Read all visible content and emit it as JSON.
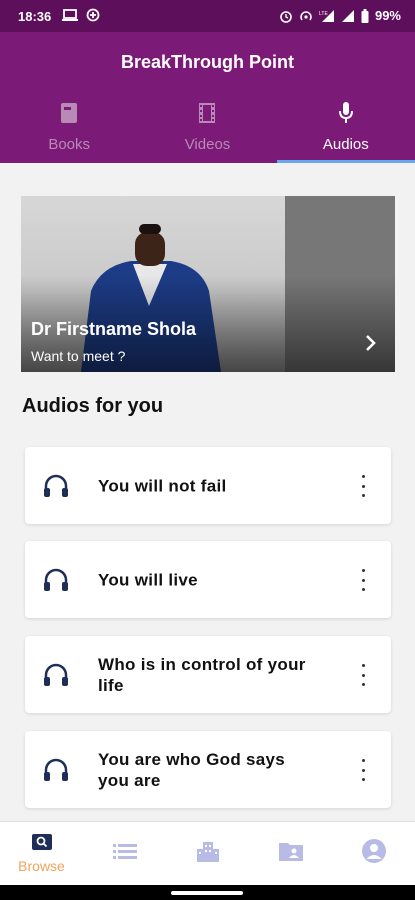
{
  "status_bar": {
    "time": "18:36",
    "battery": "99%"
  },
  "app_bar": {
    "title": "BreakThrough Point"
  },
  "tabs": [
    {
      "label": "Books",
      "icon": "book-icon",
      "active": false
    },
    {
      "label": "Videos",
      "icon": "film-icon",
      "active": false
    },
    {
      "label": "Audios",
      "icon": "microphone-icon",
      "active": true
    }
  ],
  "banner": {
    "name": "Dr Firstname Shola",
    "subtitle": "Want to meet ?"
  },
  "section": {
    "title": "Audios for you"
  },
  "audios": [
    {
      "title": "You will not fail"
    },
    {
      "title": "You will live"
    },
    {
      "title": "Who is in control of your life"
    },
    {
      "title": "You are who God says you are"
    }
  ],
  "bottom_nav": [
    {
      "label": "Browse",
      "icon": "search-icon",
      "active": true
    },
    {
      "label": "",
      "icon": "list-icon",
      "active": false
    },
    {
      "label": "",
      "icon": "buildings-icon",
      "active": false
    },
    {
      "label": "",
      "icon": "folder-user-icon",
      "active": false
    },
    {
      "label": "",
      "icon": "account-icon",
      "active": false
    }
  ],
  "colors": {
    "status_bar": "#5e0f5c",
    "app_bar": "#7c1a77",
    "tab_indicator": "#64a8f0",
    "accent": "#f0a35a",
    "nav_icon": "#b8bbe6",
    "headphone_icon": "#1f2e57"
  }
}
